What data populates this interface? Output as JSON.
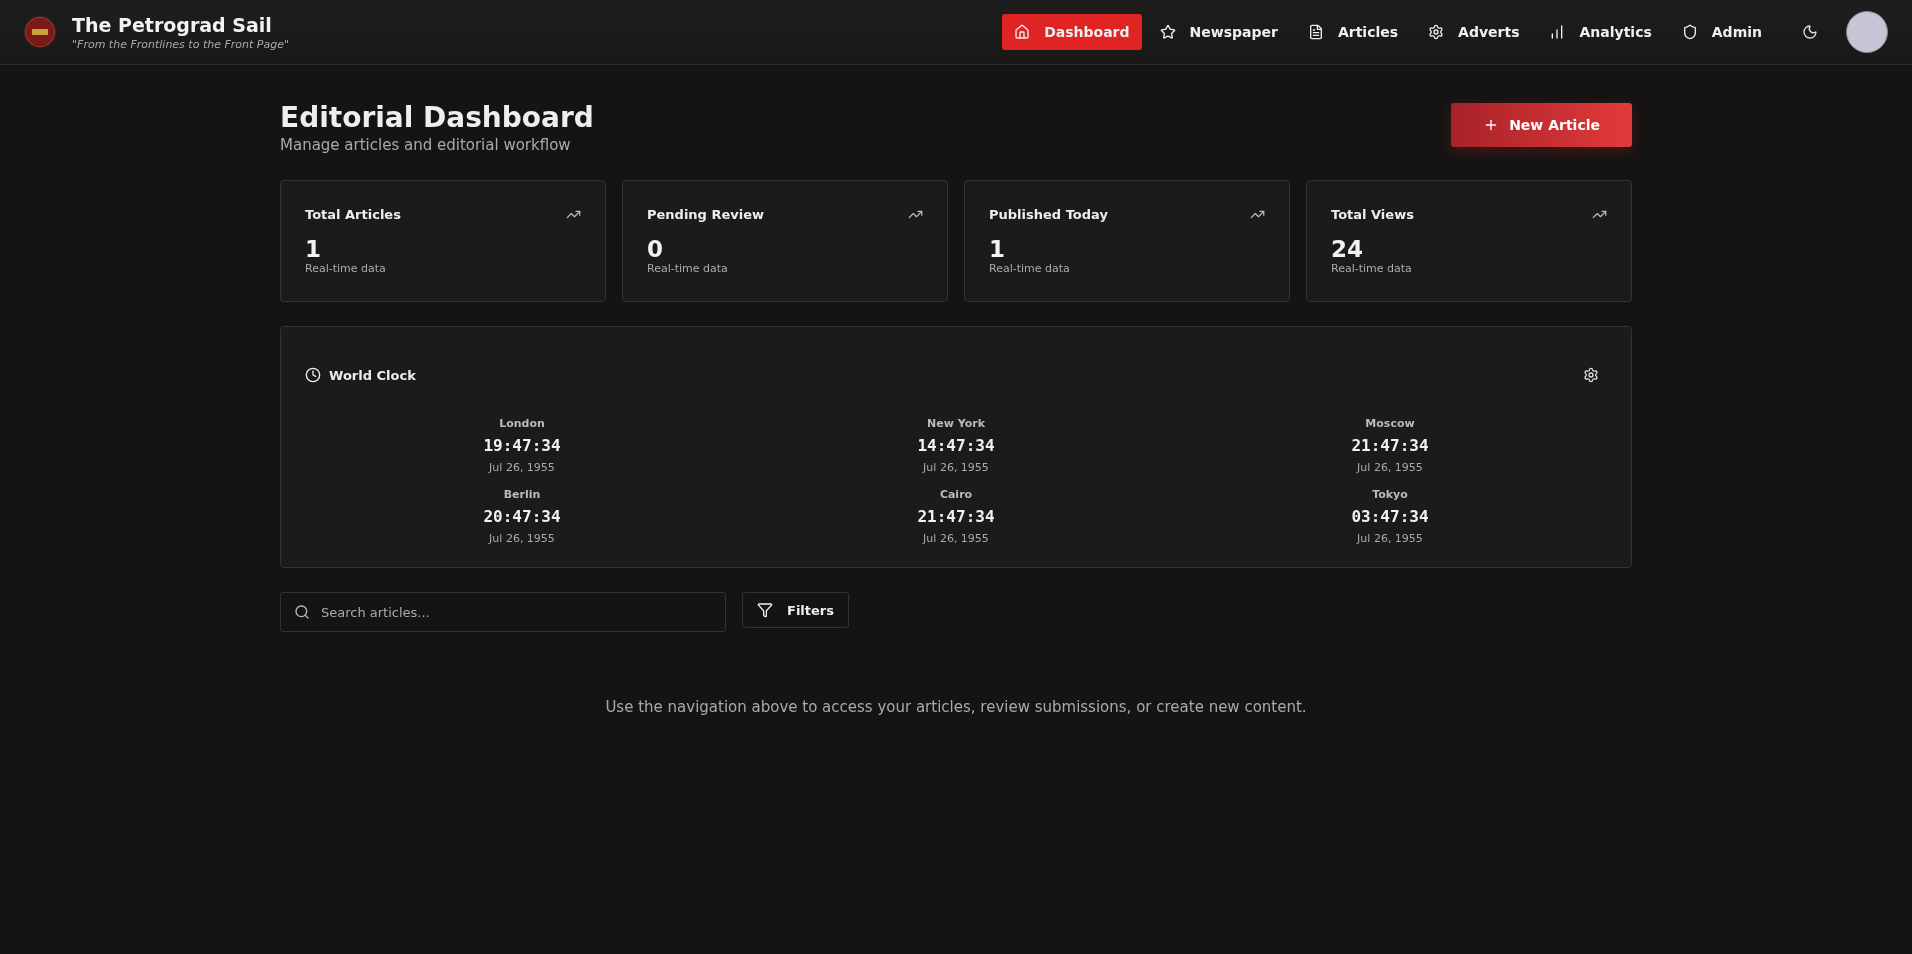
{
  "brand": {
    "title": "The Petrograd Sail",
    "tagline": "\"From the Frontlines to the Front Page\""
  },
  "nav": [
    {
      "label": "Dashboard",
      "selected": true
    },
    {
      "label": "Newspaper",
      "selected": false
    },
    {
      "label": "Articles",
      "selected": false
    },
    {
      "label": "Adverts",
      "selected": false
    },
    {
      "label": "Analytics",
      "selected": false
    },
    {
      "label": "Admin",
      "selected": false
    }
  ],
  "page": {
    "title": "Editorial Dashboard",
    "subtitle": "Manage articles and editorial workflow",
    "new_button": "New Article"
  },
  "stats": [
    {
      "label": "Total Articles",
      "value": "1",
      "note": "Real-time data"
    },
    {
      "label": "Pending Review",
      "value": "0",
      "note": "Real-time data"
    },
    {
      "label": "Published Today",
      "value": "1",
      "note": "Real-time data"
    },
    {
      "label": "Total Views",
      "value": "24",
      "note": "Real-time data"
    }
  ],
  "world_clock": {
    "title": "World Clock",
    "cities": [
      {
        "city": "London",
        "time": "19:47:34",
        "date": "Jul 26, 1955"
      },
      {
        "city": "New York",
        "time": "14:47:34",
        "date": "Jul 26, 1955"
      },
      {
        "city": "Moscow",
        "time": "21:47:34",
        "date": "Jul 26, 1955"
      },
      {
        "city": "Berlin",
        "time": "20:47:34",
        "date": "Jul 26, 1955"
      },
      {
        "city": "Cairo",
        "time": "21:47:34",
        "date": "Jul 26, 1955"
      },
      {
        "city": "Tokyo",
        "time": "03:47:34",
        "date": "Jul 26, 1955"
      }
    ]
  },
  "search": {
    "placeholder": "Search articles..."
  },
  "filters_button": "Filters",
  "message": "Use the navigation above to access your articles, review submissions, or create new content."
}
